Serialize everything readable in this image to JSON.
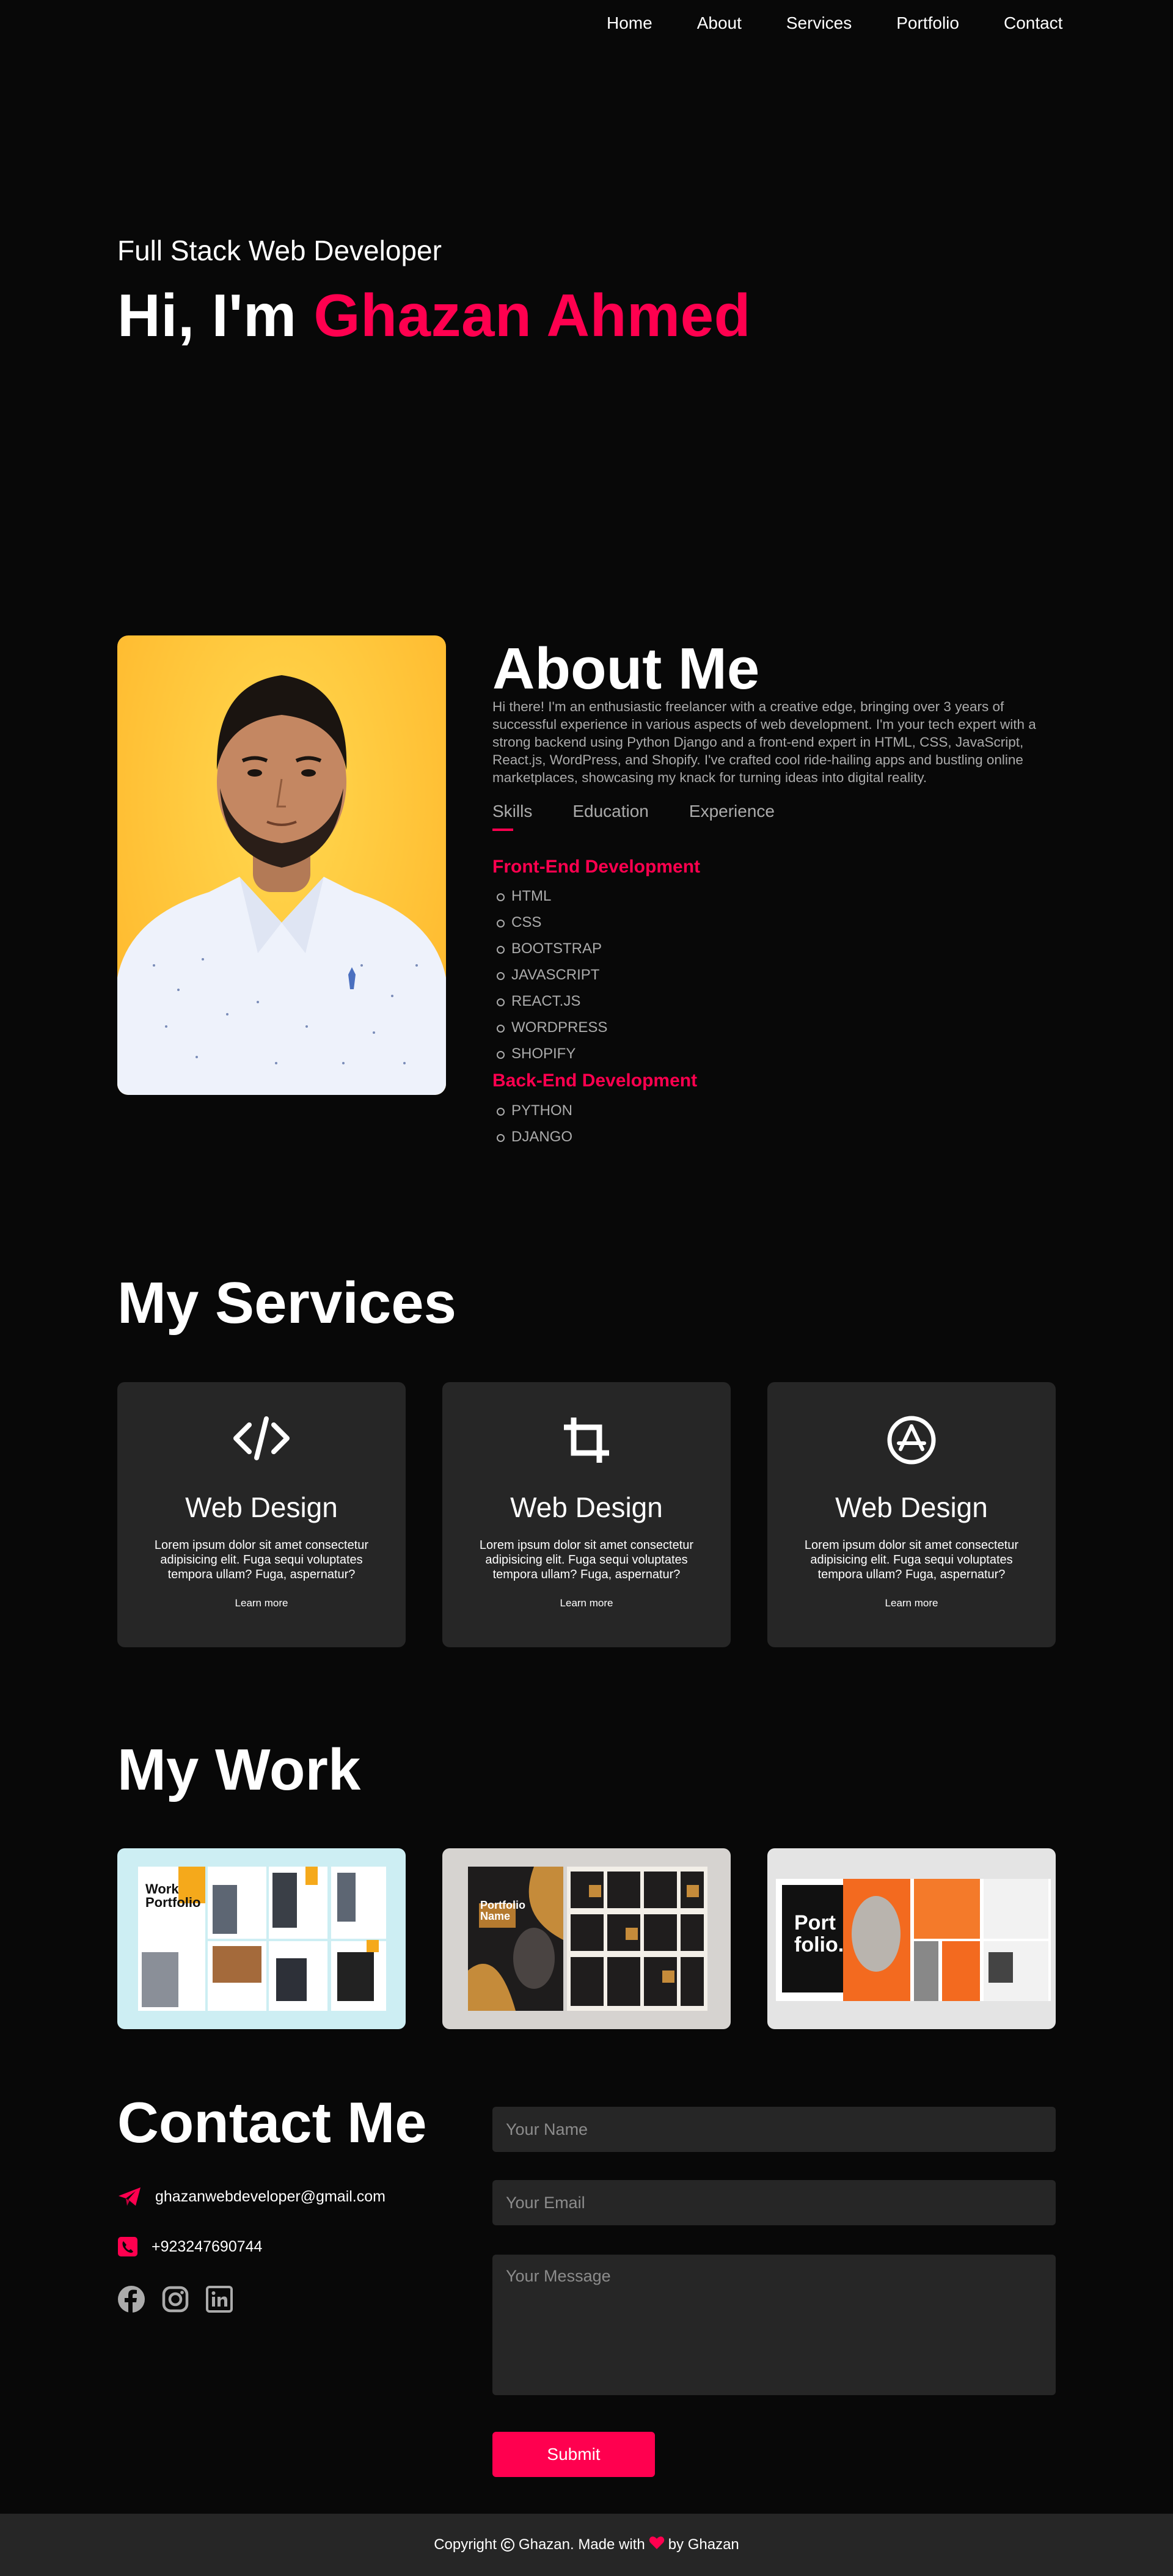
{
  "nav": {
    "items": [
      {
        "label": "Home"
      },
      {
        "label": "About"
      },
      {
        "label": "Services"
      },
      {
        "label": "Portfolio"
      },
      {
        "label": "Contact"
      }
    ]
  },
  "hero": {
    "subtitle": "Full Stack Web Developer",
    "greeting": "Hi, I'm ",
    "name": "Ghazan Ahmed"
  },
  "about": {
    "title": "About Me",
    "text": "Hi there! I'm an enthusiastic freelancer with a creative edge, bringing over 3 years of successful experience in various aspects of web development. I'm your tech expert with a strong backend using Python Django and a front-end expert in HTML, CSS, JavaScript, React.js, WordPress, and Shopify. I've crafted cool ride-hailing apps and bustling online marketplaces, showcasing my knack for turning ideas into digital reality.",
    "tabs": [
      {
        "label": "Skills",
        "active": true
      },
      {
        "label": "Education",
        "active": false
      },
      {
        "label": "Experience",
        "active": false
      }
    ],
    "frontend": {
      "heading": "Front-End Development",
      "items": [
        "HTML",
        "CSS",
        "BOOTSTRAP",
        "JAVASCRIPT",
        "REACT.JS",
        "WORDPRESS",
        "SHOPIFY"
      ]
    },
    "backend": {
      "heading": "Back-End Development",
      "items": [
        "PYTHON",
        "DJANGO"
      ]
    }
  },
  "services": {
    "title": "My Services",
    "cards": [
      {
        "icon": "code-icon",
        "title": "Web Design",
        "text": "Lorem ipsum dolor sit amet consectetur adipisicing elit. Fuga sequi voluptates tempora ullam? Fuga, aspernatur?",
        "link": "Learn more"
      },
      {
        "icon": "crop-icon",
        "title": "Web Design",
        "text": "Lorem ipsum dolor sit amet consectetur adipisicing elit. Fuga sequi voluptates tempora ullam? Fuga, aspernatur?",
        "link": "Learn more"
      },
      {
        "icon": "app-store-icon",
        "title": "Web Design",
        "text": "Lorem ipsum dolor sit amet consectetur adipisicing elit. Fuga sequi voluptates tempora ullam? Fuga, aspernatur?",
        "link": "Learn more"
      }
    ]
  },
  "work": {
    "title": "My Work",
    "items": [
      {
        "caption_line1": "Work",
        "caption_line2": "Portfolio"
      },
      {
        "caption_line1": "Portfolio",
        "caption_line2": "Name"
      },
      {
        "caption_line1": "Port",
        "caption_line2": "folio."
      }
    ]
  },
  "contact": {
    "title": "Contact Me",
    "email": "ghazanwebdeveloper@gmail.com",
    "phone": "+923247690744",
    "socials": [
      "facebook-icon",
      "instagram-icon",
      "linkedin-icon"
    ],
    "form": {
      "name_placeholder": "Your Name",
      "email_placeholder": "Your Email",
      "message_placeholder": "Your Message",
      "submit_label": "Submit"
    }
  },
  "footer": {
    "prefix": "Copyright",
    "middle": "Ghazan. Made with",
    "suffix": "by Ghazan"
  },
  "colors": {
    "background": "#080808",
    "accent": "#ff004f",
    "card": "#262626",
    "muted_text": "#ababab"
  }
}
